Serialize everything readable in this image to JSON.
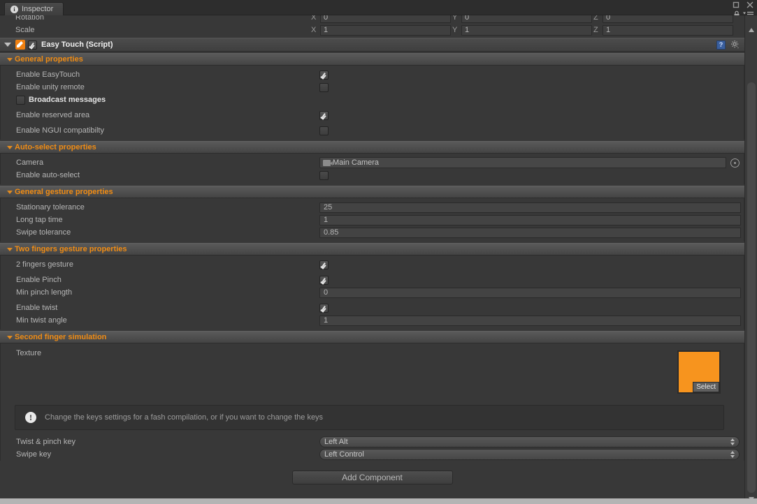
{
  "window": {
    "tab_label": "Inspector",
    "tab_icon": "info-icon",
    "maximize_icon": "maximize-icon",
    "close_icon": "close-icon",
    "lock_icon": "lock-icon",
    "menu_icon": "hamburger-menu-icon"
  },
  "transform": {
    "rotation_label": "Rotation",
    "rotation": {
      "x_axis": "X",
      "x": "0",
      "y_axis": "Y",
      "y": "0",
      "z_axis": "Z",
      "z": "0"
    },
    "scale_label": "Scale",
    "scale": {
      "x_axis": "X",
      "x": "1",
      "y_axis": "Y",
      "y": "1",
      "z_axis": "Z",
      "z": "1"
    }
  },
  "component": {
    "title": "Easy Touch (Script)",
    "enabled": true,
    "script_icon": "script-icon",
    "help_icon": "help-book-icon",
    "settings_icon": "gear-icon"
  },
  "sections": {
    "general": {
      "title": "General properties",
      "rows": [
        {
          "label": "Enable EasyTouch",
          "checked": true
        },
        {
          "label": "Enable unity remote",
          "checked": false
        },
        {
          "label": "Enable reserved area",
          "checked": true
        },
        {
          "label": "Enable NGUI compatibilty",
          "checked": false
        }
      ],
      "broadcast_label": "Broadcast messages",
      "broadcast_checked": false
    },
    "autoselect": {
      "title": "Auto-select properties",
      "camera_label": "Camera",
      "camera_value": "Main Camera",
      "camera_icon": "camera-icon",
      "picker_icon": "object-picker-icon",
      "autoselect_label": "Enable auto-select",
      "autoselect_checked": false
    },
    "gesture": {
      "title": "General gesture properties",
      "rows": [
        {
          "label": "Stationary tolerance",
          "value": "25"
        },
        {
          "label": "Long tap time",
          "value": "1"
        },
        {
          "label": "Swipe tolerance",
          "value": "0.85"
        }
      ]
    },
    "twofingers": {
      "title": "Two fingers gesture properties",
      "two_fingers_label": "2 fingers gesture",
      "two_fingers_checked": true,
      "pinch_label": "Enable Pinch",
      "pinch_checked": true,
      "min_pinch_label": "Min pinch length",
      "min_pinch_value": "0",
      "twist_label": "Enable twist",
      "twist_checked": true,
      "min_twist_label": "Min twist angle",
      "min_twist_value": "1"
    },
    "secondfinger": {
      "title": "Second finger simulation",
      "texture_label": "Texture",
      "texture_color": "#f7941e",
      "select_label": "Select",
      "help_text": "Change the keys settings for a fash compilation, or if you want to change the keys",
      "help_icon": "warning-icon",
      "twist_key_label": "Twist & pinch key",
      "twist_key_value": "Left Alt",
      "swipe_key_label": "Swipe key",
      "swipe_key_value": "Left Control"
    }
  },
  "footer": {
    "add_component_label": "Add Component"
  }
}
